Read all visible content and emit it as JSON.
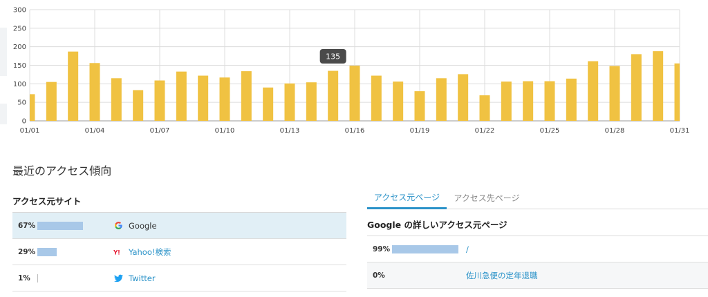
{
  "chart_data": {
    "type": "bar",
    "categories": [
      "01/01",
      "01/02",
      "01/03",
      "01/04",
      "01/05",
      "01/06",
      "01/07",
      "01/08",
      "01/09",
      "01/10",
      "01/11",
      "01/12",
      "01/13",
      "01/14",
      "01/15",
      "01/16",
      "01/17",
      "01/18",
      "01/19",
      "01/20",
      "01/21",
      "01/22",
      "01/23",
      "01/24",
      "01/25",
      "01/26",
      "01/27",
      "01/28",
      "01/29",
      "01/30",
      "01/31"
    ],
    "values": [
      72,
      105,
      187,
      156,
      115,
      83,
      109,
      133,
      122,
      117,
      134,
      90,
      101,
      104,
      135,
      149,
      122,
      106,
      80,
      115,
      126,
      69,
      106,
      107,
      107,
      114,
      161,
      148,
      180,
      188,
      155
    ],
    "x_tick_labels": [
      "01/01",
      "01/04",
      "01/07",
      "01/10",
      "01/13",
      "01/16",
      "01/19",
      "01/22",
      "01/25",
      "01/28",
      "01/31"
    ],
    "y_ticks": [
      "0",
      "50",
      "100",
      "150",
      "200",
      "250",
      "300"
    ],
    "ylim": [
      0,
      300
    ],
    "grid": true,
    "bar_color": "#f0c242",
    "tooltip": {
      "category": "01/15",
      "value": "135"
    }
  },
  "recent": {
    "title": "最近のアクセス傾向",
    "sites_title": "アクセス元サイト",
    "sites": [
      {
        "pct": "67%",
        "fraction": 0.67,
        "name": "Google",
        "icon": "google-icon",
        "selected": true
      },
      {
        "pct": "29%",
        "fraction": 0.29,
        "name": "Yahoo!検索",
        "icon": "yahoo-icon",
        "selected": false
      },
      {
        "pct": "1%",
        "fraction": 0.01,
        "name": "Twitter",
        "icon": "twitter-icon",
        "selected": false
      }
    ],
    "tabs": {
      "active": "アクセス元ページ",
      "inactive": "アクセス先ページ"
    },
    "detail_title": "Google の詳しいアクセス元ページ",
    "pages": [
      {
        "pct": "99%",
        "fraction": 0.99,
        "name": "/"
      },
      {
        "pct": "0%",
        "fraction": 0.0,
        "name": "佐川急便の定年退職"
      }
    ]
  },
  "colors": {
    "accent": "#2a92c8",
    "bar": "#f0c242",
    "share_bar": "#a8c8e8",
    "selected_row": "#e1eff6"
  }
}
